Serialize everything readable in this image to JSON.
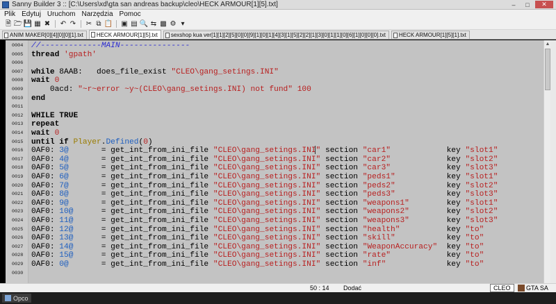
{
  "window": {
    "title": "Sanny Builder 3 :: [C:\\Users\\xd\\gta san andreas backup\\cleo\\HECK ARMOUR[1][5].txt]"
  },
  "menu": {
    "items": [
      "Plik",
      "Edytuj",
      "Uruchom",
      "Narzędzia",
      "Pomoc"
    ]
  },
  "tabs": [
    {
      "label": "ANIM MAKER[0][4][0][0][1].txt"
    },
    {
      "label": "HECK ARMOUR[1][5].txt"
    },
    {
      "label": "sexshop kua ver[1][1][2][5][0][0][9][1][0][1][4][3][1][5][2][2][1][3][0][1][1][0][6][1][0][0][0].txt"
    },
    {
      "label": "HECK ARMOUR[1][5][1].txt"
    }
  ],
  "code": {
    "line_numbers": [
      "0004",
      "0005",
      "0006",
      "0007",
      "0008",
      "0009",
      "0010",
      "0011",
      "0012",
      "0013",
      "0014",
      "0015",
      "0016",
      "0017",
      "0018",
      "0019",
      "0020",
      "0021",
      "0022",
      "0023",
      "0024",
      "0025",
      "0026",
      "0027",
      "0028",
      "0029",
      "0030"
    ],
    "lines": [
      "//-------------MAIN---------------",
      "thread 'gpath'",
      "",
      "while 8AAB:   does_file_exist \"CLEO\\gang_setings.INI\"",
      "wait 0",
      "    0acd: \"~r~error ~y~(CLEO\\gang_setings.INI) not fund\" 100",
      "end",
      "",
      "WHILE TRUE",
      "repeat",
      "wait 0",
      "until if Player.Defined(0)",
      "0AF0: 3@       = get_int_from_ini_file \"CLEO\\gang_setings.INI\" section \"car1\"            key \"slot1\"",
      "0AF0: 4@       = get_int_from_ini_file \"CLEO\\gang_setings.INI\" section \"car2\"            key \"slot2\"",
      "0AF0: 5@       = get_int_from_ini_file \"CLEO\\gang_setings.INI\" section \"car3\"            key \"slot3\"",
      "0AF0: 6@       = get_int_from_ini_file \"CLEO\\gang_setings.INI\" section \"peds1\"           key \"slot1\"",
      "0AF0: 7@       = get_int_from_ini_file \"CLEO\\gang_setings.INI\" section \"peds2\"           key \"slot2\"",
      "0AF0: 8@       = get_int_from_ini_file \"CLEO\\gang_setings.INI\" section \"peds3\"           key \"slot3\"",
      "0AF0: 9@       = get_int_from_ini_file \"CLEO\\gang_setings.INI\" section \"weapons1\"        key \"slot1\"",
      "0AF0: 10@      = get_int_from_ini_file \"CLEO\\gang_setings.INI\" section \"weapons2\"        key \"slot2\"",
      "0AF0: 11@      = get_int_from_ini_file \"CLEO\\gang_setings.INI\" section \"weapons3\"        key \"slot3\"",
      "0AF0: 12@      = get_int_from_ini_file \"CLEO\\gang_setings.INI\" section \"health\"          key \"to\"",
      "0AF0: 13@      = get_int_from_ini_file \"CLEO\\gang_setings.INI\" section \"skill\"           key \"to\"",
      "0AF0: 14@      = get_int_from_ini_file \"CLEO\\gang_setings.INI\" section \"WeaponAccuracy\"  key \"to\"",
      "0AF0: 15@      = get_int_from_ini_file \"CLEO\\gang_setings.INI\" section \"rate\"            key \"to\"",
      "0AF0: 0@       = get_int_from_ini_file \"CLEO\\gang_setings.INI\" section \"inf\"             key \"to\"",
      ""
    ]
  },
  "status": {
    "position": "50 : 14",
    "mode": "Dodać",
    "language": "CLEO",
    "game": "GTA SA"
  },
  "taskbar": {
    "item": "Opco"
  },
  "icons": [
    "new-icon",
    "open-icon",
    "save-icon",
    "save-all-icon",
    "close-icon",
    "undo-icon",
    "redo-icon",
    "cut-icon",
    "copy-icon",
    "paste-icon",
    "compile-icon",
    "decompile-icon",
    "find-icon",
    "replace-icon",
    "image-icon",
    "settings-icon"
  ]
}
